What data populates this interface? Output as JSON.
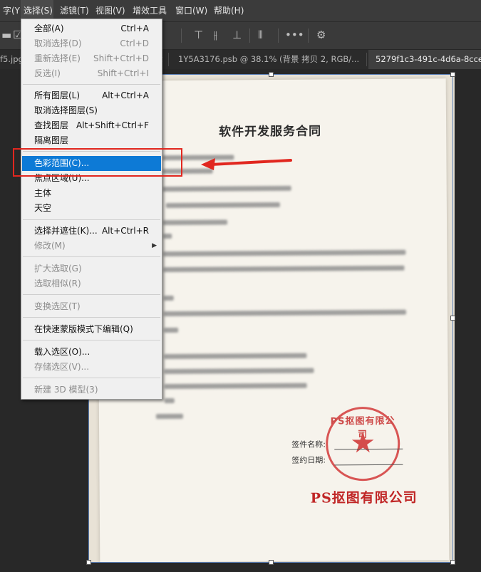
{
  "menubar": {
    "items": [
      {
        "label": "字(Y)"
      },
      {
        "label": "选择(S)"
      },
      {
        "label": "滤镜(T)"
      },
      {
        "label": "视图(V)"
      },
      {
        "label": "增效工具"
      },
      {
        "label": "窗口(W)"
      },
      {
        "label": "帮助(H)"
      }
    ]
  },
  "tabs": [
    {
      "label": "f5.jpg"
    },
    {
      "label": "1Y5A3176.psb @ 38.1% (背景 拷贝 2, RGB/..."
    },
    {
      "label": "5279f1c3-491c-4d6a-8cce-8"
    }
  ],
  "select_menu": {
    "items": [
      {
        "label": "全部(A)",
        "shortcut": "Ctrl+A",
        "enabled": true
      },
      {
        "label": "取消选择(D)",
        "shortcut": "Ctrl+D",
        "enabled": false
      },
      {
        "label": "重新选择(E)",
        "shortcut": "Shift+Ctrl+D",
        "enabled": false
      },
      {
        "label": "反选(I)",
        "shortcut": "Shift+Ctrl+I",
        "enabled": false
      },
      {
        "label": "所有图层(L)",
        "shortcut": "Alt+Ctrl+A",
        "enabled": true
      },
      {
        "label": "取消选择图层(S)",
        "shortcut": "",
        "enabled": true
      },
      {
        "label": "查找图层",
        "shortcut": "Alt+Shift+Ctrl+F",
        "enabled": true
      },
      {
        "label": "隔离图层",
        "shortcut": "",
        "enabled": true
      },
      {
        "label": "色彩范围(C)...",
        "shortcut": "",
        "enabled": true,
        "highlighted": true
      },
      {
        "label": "焦点区域(U)...",
        "shortcut": "",
        "enabled": true
      },
      {
        "label": "主体",
        "shortcut": "",
        "enabled": true
      },
      {
        "label": "天空",
        "shortcut": "",
        "enabled": true
      },
      {
        "label": "选择并遮住(K)...",
        "shortcut": "Alt+Ctrl+R",
        "enabled": true
      },
      {
        "label": "修改(M)",
        "shortcut": "",
        "enabled": false,
        "submenu": true
      },
      {
        "label": "扩大选取(G)",
        "shortcut": "",
        "enabled": false
      },
      {
        "label": "选取相似(R)",
        "shortcut": "",
        "enabled": false
      },
      {
        "label": "变换选区(T)",
        "shortcut": "",
        "enabled": false
      },
      {
        "label": "在快速蒙版模式下编辑(Q)",
        "shortcut": "",
        "enabled": true
      },
      {
        "label": "载入选区(O)...",
        "shortcut": "",
        "enabled": true
      },
      {
        "label": "存储选区(V)...",
        "shortcut": "",
        "enabled": false
      },
      {
        "label": "新建 3D 模型(3)",
        "shortcut": "",
        "enabled": false
      }
    ]
  },
  "document": {
    "title": "软件开发服务合同",
    "sign_name_label": "签件名称:",
    "sign_date_label": "签约日期:",
    "company": "PS抠图有限公司",
    "seal_text": "PS抠图有限公司"
  },
  "annotation": {
    "color": "#e1271f"
  },
  "colors": {
    "highlight": "#0d7ad6",
    "seal_red": "#c8302f"
  }
}
